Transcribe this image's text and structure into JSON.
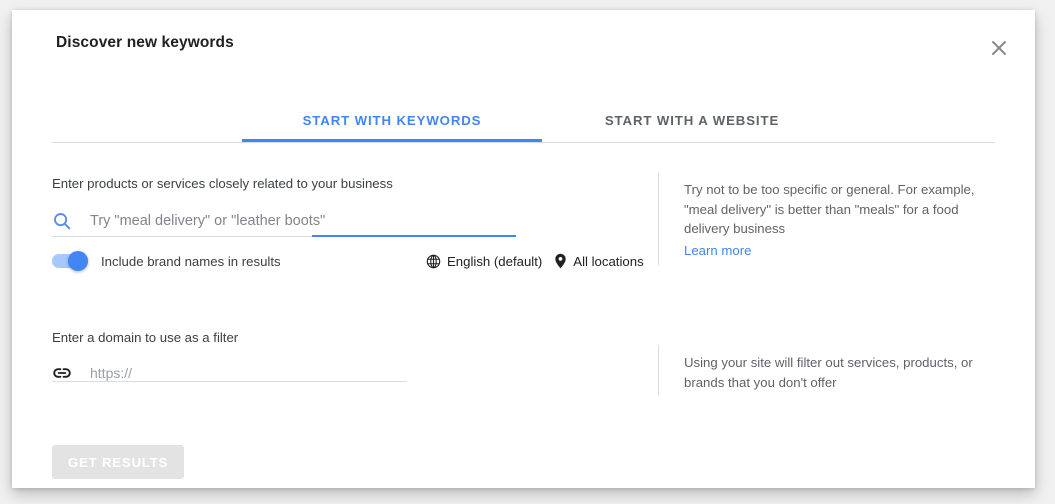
{
  "dialog": {
    "title": "Discover new keywords",
    "close_icon": "close-icon"
  },
  "tabs": [
    {
      "label": "START WITH KEYWORDS",
      "active": true
    },
    {
      "label": "START WITH A WEBSITE",
      "active": false
    }
  ],
  "keywords_section": {
    "label": "Enter products or services closely related to your business",
    "search_icon": "search-icon",
    "input_value": "",
    "input_placeholder": "Try \"meal delivery\" or \"leather boots\"",
    "toggle": {
      "label": "Include brand names in results",
      "state": "on"
    },
    "chips": [
      {
        "icon": "globe-icon",
        "label": "English (default)"
      },
      {
        "icon": "location-pin-icon",
        "label": "All locations"
      }
    ],
    "hint": "Try not to be too specific or general. For example, \"meal delivery\" is better than \"meals\" for a food delivery business",
    "learn_more": "Learn more"
  },
  "domain_section": {
    "label": "Enter a domain to use as a filter",
    "link_icon": "link-icon",
    "input_value": "",
    "input_placeholder": "https://",
    "hint": "Using your site will filter out services, products, or brands that you don't offer"
  },
  "footer": {
    "submit_label": "GET RESULTS",
    "submit_disabled": true
  },
  "colors": {
    "accent": "#4285f4",
    "text_primary": "#202124",
    "text_secondary": "#5f6368",
    "divider": "#dadce0",
    "disabled_button_bg": "#e3e3e3"
  }
}
